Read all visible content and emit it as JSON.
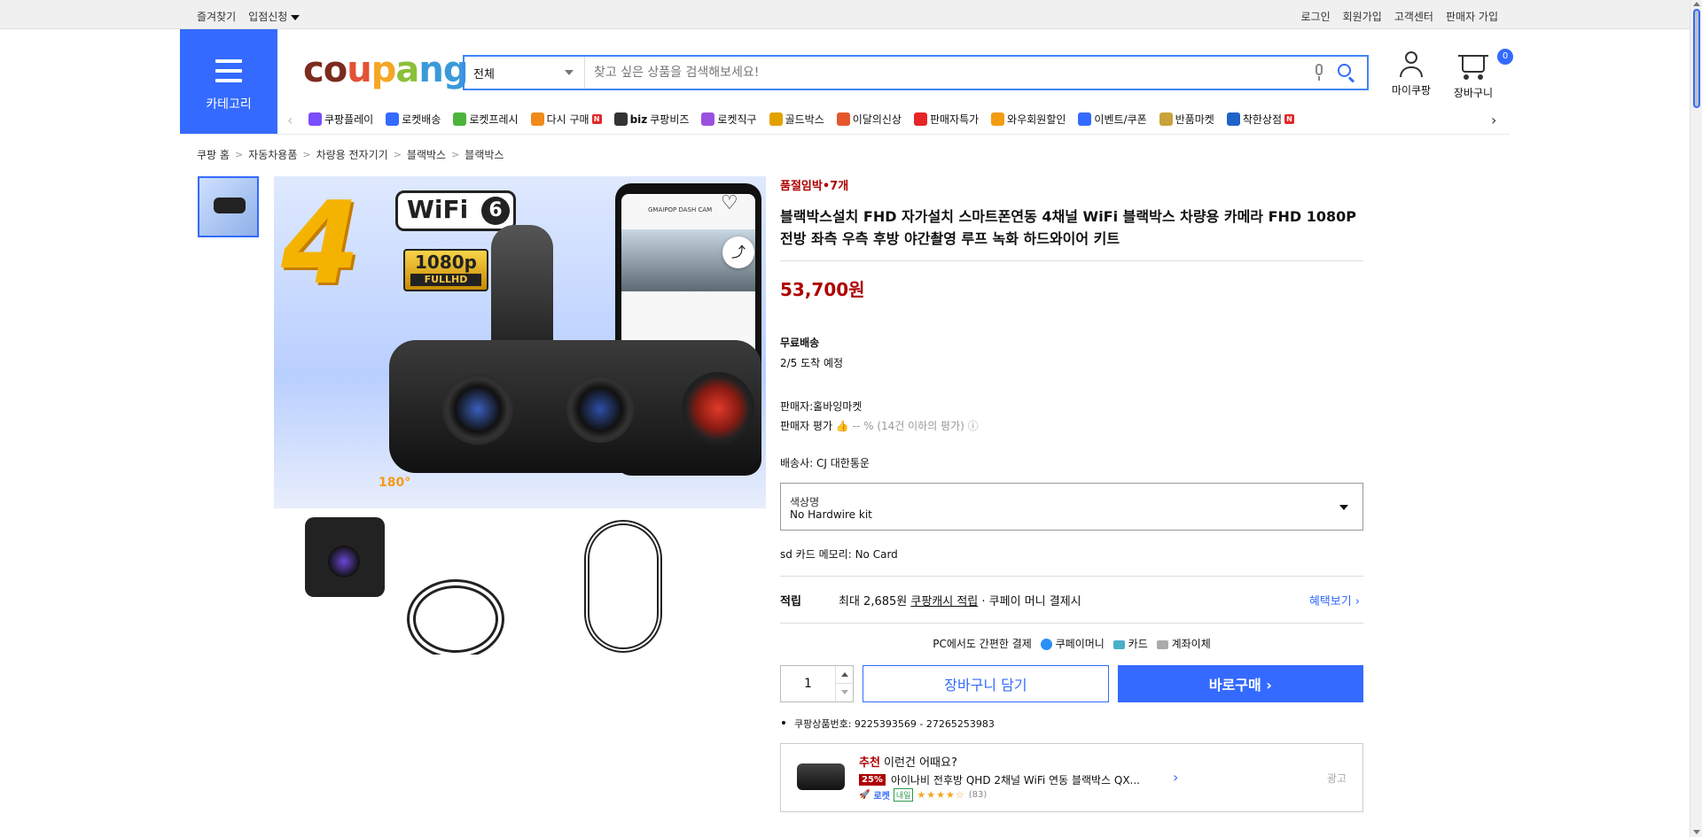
{
  "topbar": {
    "left": [
      "즐겨찾기",
      "입점신청"
    ],
    "right": [
      "로그인",
      "회원가입",
      "고객센터",
      "판매자 가입"
    ]
  },
  "header": {
    "category_label": "카테고리",
    "logo_text": "coupang",
    "search_scope": "전체",
    "search_placeholder": "찾고 싶은 상품을 검색해보세요!",
    "my_coupang": "마이쿠팡",
    "cart_label": "장바구니",
    "cart_count": "0"
  },
  "nav": {
    "items": [
      {
        "label": "쿠팡플레이",
        "icon": "play-icon",
        "color": "#7a4dff"
      },
      {
        "label": "로켓배송",
        "icon": "rocket-icon",
        "color": "#346aff"
      },
      {
        "label": "로켓프레시",
        "icon": "rocket-fresh-icon",
        "color": "#4db33d"
      },
      {
        "label": "다시 구매",
        "icon": "repurchase-icon",
        "color": "#f08a1a",
        "badge": "N"
      },
      {
        "label": "쿠팡비즈",
        "icon": "biz-icon",
        "color": "#333333",
        "prefix": "biz"
      },
      {
        "label": "로켓직구",
        "icon": "global-icon",
        "color": "#9b51e0"
      },
      {
        "label": "골드박스",
        "icon": "goldbox-icon",
        "color": "#e3a100"
      },
      {
        "label": "이달의신상",
        "icon": "new-icon",
        "color": "#e5572b"
      },
      {
        "label": "판매자특가",
        "icon": "percent-icon",
        "color": "#e52528"
      },
      {
        "label": "와우회원할인",
        "icon": "wow-icon",
        "color": "#f39c12"
      },
      {
        "label": "이벤트/쿠폰",
        "icon": "coupon-icon",
        "color": "#346aff"
      },
      {
        "label": "반품마켓",
        "icon": "market-icon",
        "color": "#c8a33a"
      },
      {
        "label": "착한상점",
        "icon": "shop-icon",
        "color": "#1f64c8",
        "badge": "N"
      }
    ]
  },
  "breadcrumb": [
    "쿠팡 홈",
    "자동차용품",
    "차량용 전자기기",
    "블랙박스",
    "블랙박스"
  ],
  "product": {
    "image": {
      "wifi_text": "WiFi",
      "wifi_num": "6",
      "res_big": "1080p",
      "res_small": "FULLHD",
      "angle": "180°",
      "phone_header": "GMAIPOP DASH CAM"
    },
    "stock": "품절임박•7개",
    "title": "블랙박스설치 FHD 자가설치 스마트폰연동 4채널 WiFi 블랙박스 차량용 카메라 FHD 1080P 전방 좌측 우측 후방 야간촬영 루프 녹화 하드와이어 키트",
    "price": "53,700원",
    "shipping": "무료배송",
    "eta": "2/5 도착 예정",
    "seller_label": "판매자:",
    "seller_name": "홀바잉마켓",
    "rating_label": "판매자 평가",
    "rating_value": "-- % (14건 이하의 평가)",
    "courier_label": "배송사:",
    "courier_name": "CJ 대한통운",
    "option_label": "색상명",
    "option_value": "No Hardwire kit",
    "sd_label": "sd 카드 메모리:",
    "sd_value": "No Card",
    "points_key": "적립",
    "points_text": "최대 2,685원",
    "points_link_text": "쿠팡캐시 적립",
    "points_suffix": "· 쿠페이 머니 결제시",
    "points_more": "혜택보기 ›",
    "pay_lead": "PC에서도 간편한 결제",
    "pay_methods": [
      "쿠페이머니",
      "카드",
      "계좌이체"
    ],
    "qty": "1",
    "btn_cart": "장바구니 담기",
    "btn_buy": "바로구매 ›",
    "product_no": "쿠팡상품번호: 9225393569 - 27265253983"
  },
  "recommend": {
    "head_red": "추천",
    "head_rest": " 이런건 어때요?",
    "discount": "25%",
    "name": "아이나비 전후방 QHD 2채널 WiFi 연동 블랙박스 QX...",
    "rocket": "로켓",
    "tomorrow": "내일",
    "stars": "★★★★☆",
    "count": "(83)",
    "ad": "광고"
  },
  "colors": {
    "accent": "#346aff",
    "price": "#ae0000"
  }
}
